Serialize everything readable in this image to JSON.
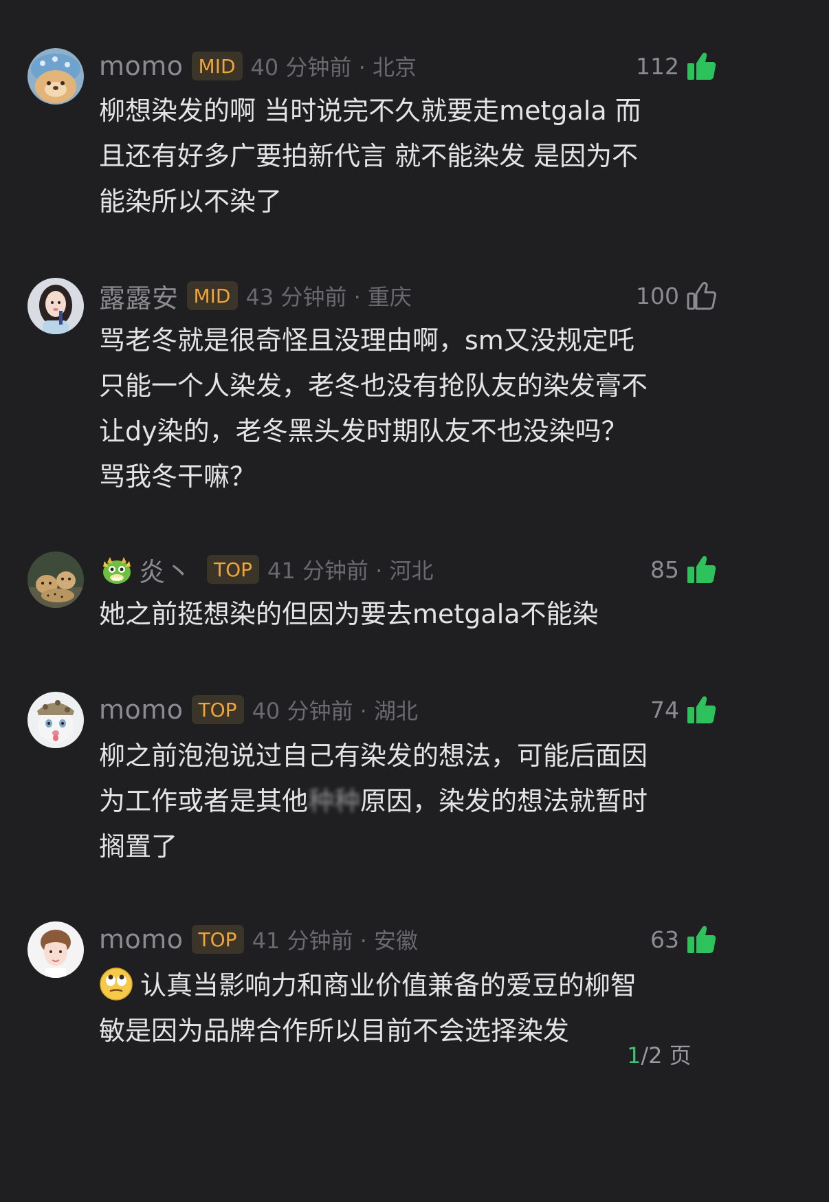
{
  "comments": [
    {
      "username": "momo",
      "badge": "MID",
      "time": "40 分钟前",
      "location": "北京",
      "likes": "112",
      "liked": true,
      "avatar_icon": "plush-toy-avatar",
      "lines": [
        "柳想染发的啊 当时说完不久就要走metgala 而",
        "且还有好多广要拍新代言 就不能染发 是因为不",
        "能染所以不染了"
      ]
    },
    {
      "username": "露露安",
      "badge": "MID",
      "time": "43 分钟前",
      "location": "重庆",
      "likes": "100",
      "liked": false,
      "avatar_icon": "woman-portrait-avatar",
      "lines": [
        "骂老冬就是很奇怪且没理由啊，sm又没规定吒",
        "只能一个人染发，老冬也没有抢队友的染发膏不",
        "让dy染的，老冬黑头发时期队友不也没染吗？",
        "骂我冬干嘛？"
      ]
    },
    {
      "username": "炎丶",
      "badge": "TOP",
      "time": "41 分钟前",
      "location": "河北",
      "likes": "85",
      "liked": true,
      "avatar_icon": "cheetah-avatar",
      "username_icon": "dragon-emoji-icon",
      "lines": [
        "她之前挺想染的但因为要去metgala不能染"
      ]
    },
    {
      "username": "momo",
      "badge": "TOP",
      "time": "40 分钟前",
      "location": "湖北",
      "likes": "74",
      "liked": true,
      "avatar_icon": "cat-with-hat-avatar",
      "lines": [
        "柳之前泡泡说过自己有染发的想法，可能后面因",
        "为工作或者是其他",
        "原因，染发的想法就暂时",
        "搁置了"
      ],
      "blurred_text": "种种"
    },
    {
      "username": "momo",
      "badge": "TOP",
      "time": "41 分钟前",
      "location": "安徽",
      "likes": "63",
      "liked": true,
      "avatar_icon": "man-portrait-avatar",
      "emoji_icon": "eye-roll-emoji-icon",
      "lines": [
        "认真当影响力和商业价值兼备的爱豆的柳智",
        "敏是因为品牌合作所以目前不会选择染发"
      ]
    }
  ],
  "pager": {
    "current": "1",
    "total": "/2 页"
  },
  "colors": {
    "background": "#1f1f21",
    "like_green": "#2ec25c",
    "badge_text": "#f0a43b",
    "badge_bg": "#3a3528",
    "pager_current": "#43c07a"
  }
}
